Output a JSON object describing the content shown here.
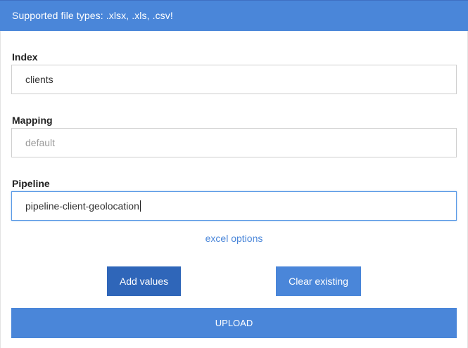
{
  "banner": {
    "text": "Supported file types: .xlsx, .xls, .csv!"
  },
  "form": {
    "index": {
      "label": "Index",
      "value": "clients"
    },
    "mapping": {
      "label": "Mapping",
      "placeholder": "default",
      "value": ""
    },
    "pipeline": {
      "label": "Pipeline",
      "value": "pipeline-client-geolocation"
    }
  },
  "links": {
    "excel_options": "excel options"
  },
  "buttons": {
    "add_values": "Add values",
    "clear_existing": "Clear existing",
    "upload": "UPLOAD"
  },
  "colors": {
    "accent": "#4a86d9",
    "accent_dark": "#2f66b9",
    "focus_border": "#5b9be6"
  }
}
